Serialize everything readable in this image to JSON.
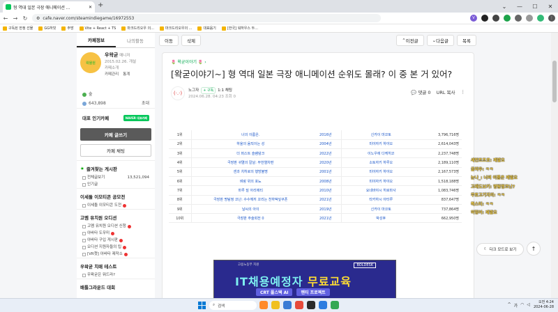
{
  "browser": {
    "tab_title": "형 역대 일본 극장 애니메이션 ...",
    "url": "cafe.naver.com/steamindiegame/16972553",
    "bookmarks": [
      "구독된 한정 선물",
      "GG하빗",
      "주방",
      "Vite + React + TS",
      "마크드리오우 의...",
      "마크드리오우의 ...",
      "대표음기",
      "[한국] 워하우스 두..."
    ]
  },
  "sidebar": {
    "tabs": [
      "카페정보",
      "나의활동"
    ],
    "profile": {
      "name": "우왁굳",
      "badge": "매니저",
      "since": "2015.02.26. 개설",
      "cafe_intro": "카페소개",
      "manage": "카페관리",
      "stats": "통계",
      "avatar_text": "왁물원"
    },
    "grade": "숲",
    "members_label": "643,898",
    "invite": "초대",
    "popular": "대표 인기카페",
    "npay_badge": "NAVER 대표카페",
    "write_button": "카페 글쓰기",
    "chat_button": "카페 채팅",
    "fav_header": "즐겨찾는 게시판",
    "board_items": [
      {
        "label": "전체글보기",
        "count": "13,521,094"
      },
      {
        "label": "인기글",
        "count": ""
      }
    ],
    "sections": [
      {
        "header": "이세돌 이모티콘 공모전",
        "items": [
          "이세돌 이모티콘 도전"
        ]
      },
      {
        "header": "고멤 유치원 오디션",
        "items": [
          "고멤 유치원 오디션 신청",
          "아바타 도우미",
          "아바타 구입 게시판",
          "오디션 지원자들의 팁",
          "[VR챗] 아바타 제작소"
        ]
      },
      {
        "header": "우왁굳 치매 테스트",
        "items": [
          "우왁굳은 뭐드라?"
        ]
      },
      {
        "header": "배틀그라운드 대회 "
      }
    ]
  },
  "toolbar": {
    "move": "이동",
    "delete": "삭제",
    "prev": "이전글",
    "next": "다음글",
    "list": "목록"
  },
  "article": {
    "category": "왁굳이야기",
    "title": "[왁굳이야기~] 형 역대 일본 극장 애니메이션 순위도 몰래? 이 중 본 거 있어?",
    "author": "노그자",
    "follow": "+ 구독",
    "chat": "1:1 채팅",
    "date": "2024.06.28. 04:23",
    "views": "조회 0",
    "comments": "댓글 0",
    "copy_url": "URL 복사",
    "table": [
      {
        "rank": "1위",
        "title": "너의 이름은.",
        "year": "2016년",
        "director": "신카이 마코토",
        "viewers": "3,796,716명"
      },
      {
        "rank": "2위",
        "title": "하울의 움직이는 성",
        "year": "2004년",
        "director": "미야자키 하야오",
        "viewers": "2,614,043명"
      },
      {
        "rank": "3위",
        "title": "더 퍼스트 슬램덩크",
        "year": "2022년",
        "director": "이노우에 다케히코",
        "viewers": "2,237,748명"
      },
      {
        "rank": "4위",
        "title": "극장판 귀멸의 칼날: 무한열차편",
        "year": "2020년",
        "director": "소토자키 하루오",
        "viewers": "2,189,110명"
      },
      {
        "rank": "5위",
        "title": "센과 치히로의 행방불명",
        "year": "2001년",
        "director": "미야자키 하야오",
        "viewers": "2,167,573명"
      },
      {
        "rank": "6위",
        "title": "벼랑 위의 포뇨",
        "year": "2008년",
        "director": "미야자키 하야오",
        "viewers": "1,518,188명"
      },
      {
        "rank": "7위",
        "title": "마루 밑 아리에티",
        "year": "2010년",
        "director": "요네바야시 히로마사",
        "viewers": "1,083,746명"
      },
      {
        "rank": "8위",
        "title": "극장판 명탐정 코난: 수수께끼 꼬리는 천하떡잎쿠폰",
        "year": "2021년",
        "director": "타카하시 아터루",
        "viewers": "837,647명"
      },
      {
        "rank": "9위",
        "title": "날씨의 아이",
        "year": "2019년",
        "director": "신카이 마코토",
        "viewers": "737,864명"
      },
      {
        "rank": "10위",
        "title": "극장판 주술회전 0",
        "year": "2021년",
        "director": "박성후",
        "viewers": "662,950명"
      }
    ]
  },
  "banner": {
    "sub": "고용노동부 지원",
    "brand": "BOLDESK",
    "headline_1": "IT채용예정자",
    "headline_2": " 무료교육",
    "pill_1": "CRT 풀스택 AI",
    "pill_2": "멘티 프로젝트"
  },
  "chat_overlay": [
    "세인트프로: 제발요",
    "굴리우: ㅋㅋ",
    "눈나_: 너의 이름은 제발요",
    "고래도보키: 명탐정코난?",
    "무토고기자리: ㅋㅋ",
    "뤽스터: ㅋㅋ",
    "허밍어: 제발요"
  ],
  "dark_mode": "다크 모드로 보기",
  "taskbar": {
    "search": "검색",
    "time": "오전 4:24",
    "date": "2024-06-28"
  }
}
